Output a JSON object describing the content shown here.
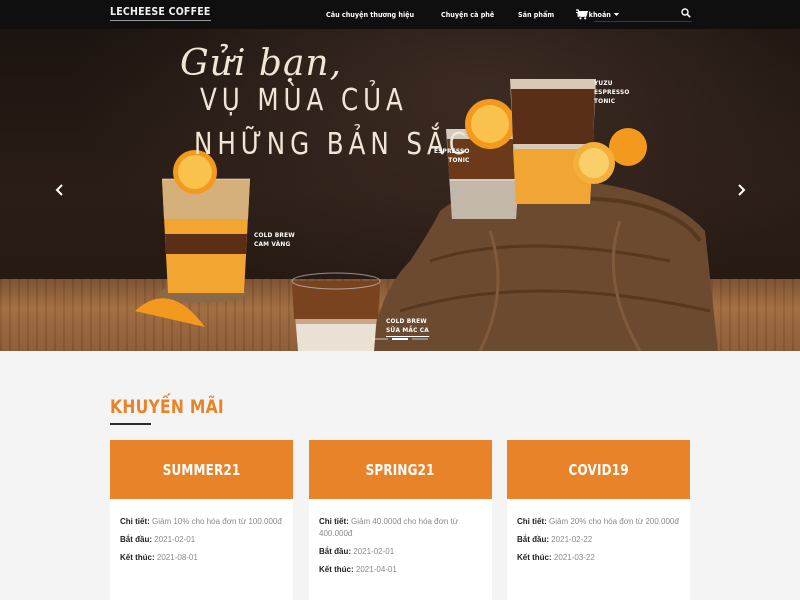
{
  "brand": "LECHEESE COFFEE",
  "nav": {
    "links": [
      "Câu chuyện thương hiệu",
      "Chuyện cà phê",
      "Sản phẩm",
      "Tài khoản"
    ],
    "search_placeholder": ""
  },
  "hero": {
    "script": "Gửi bạn,",
    "headline_1": "VỤ MÙA CỦA",
    "headline_2": "NHỮNG BẢN SẮC",
    "labels": {
      "yuzu": [
        "YUZU",
        "ESPRESSO",
        "TONIC"
      ],
      "espresso": [
        "ESPRESSO",
        "TONIC"
      ],
      "cam": [
        "COLD BREW",
        "CAM VÀNG"
      ],
      "macca": [
        "COLD BREW",
        "SỮA MẮC CA"
      ]
    },
    "slide_count": 3,
    "active_slide": 1
  },
  "promo": {
    "title": "KHUYẾN MÃI",
    "label_detail": "Chi tiết:",
    "label_start": "Bắt đầu:",
    "label_end": "Kết thúc:",
    "cards": [
      {
        "code": "SUMMER21",
        "detail": "Giảm 10% cho hóa đơn từ 100.000đ",
        "start": "2021-02-01",
        "end": "2021-08-01"
      },
      {
        "code": "SPRING21",
        "detail": "Giảm 40.000đ cho hóa đơn từ 400.000đ",
        "start": "2021-02-01",
        "end": "2021-04-01"
      },
      {
        "code": "COVID19",
        "detail": "Giảm 20% cho hóa đơn từ 200.000đ",
        "start": "2021-02-22",
        "end": "2021-03-22"
      }
    ]
  },
  "colors": {
    "accent": "#e8832a",
    "navbar": "#0f0f0f"
  },
  "icons": {
    "cart": "shopping-cart-icon",
    "search": "search-icon",
    "prev": "chevron-left-icon",
    "next": "chevron-right-icon"
  }
}
